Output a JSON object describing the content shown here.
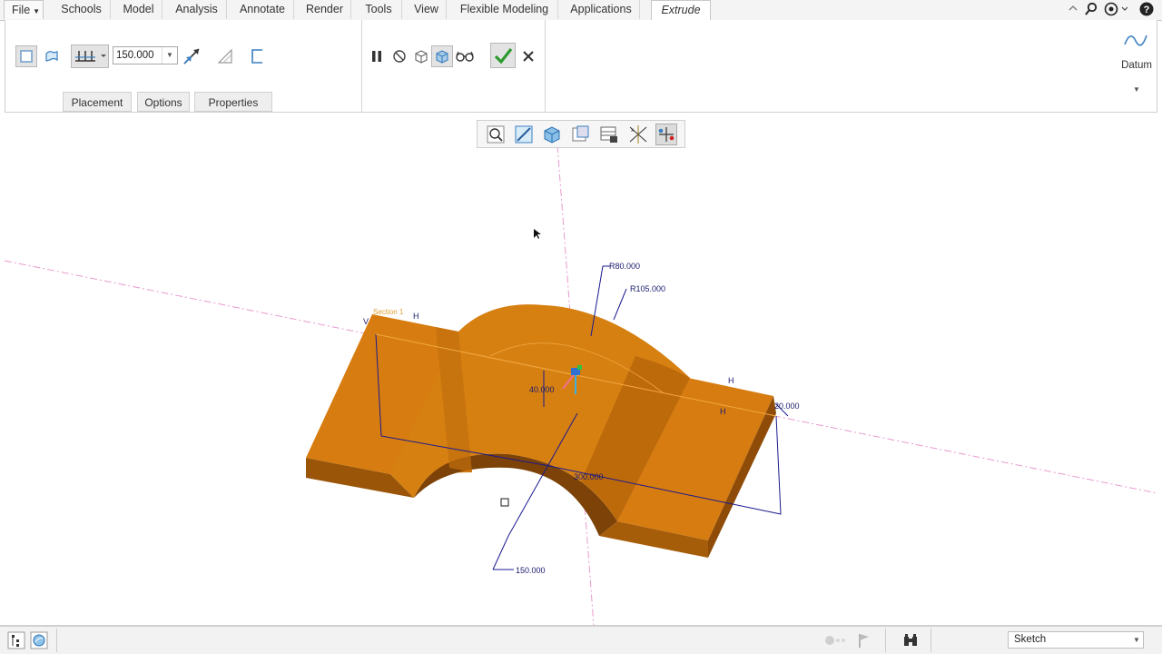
{
  "menubar": {
    "file_label": "File",
    "items": [
      "Schools",
      "Model",
      "Analysis",
      "Annotate",
      "Render",
      "Tools",
      "View",
      "Flexible Modeling",
      "Applications"
    ],
    "active_tab": "Extrude"
  },
  "ribbon": {
    "depth_value": "150.000",
    "tabs": {
      "placement": "Placement",
      "options": "Options",
      "properties": "Properties"
    },
    "datum_label": "Datum"
  },
  "viewport": {
    "dimensions": {
      "r80": "R80.000",
      "r105": "R105.000",
      "d40": "40.000",
      "d300": "300.000",
      "d20": "20.000",
      "d150": "150.000",
      "section": "Section 1",
      "h_mark": "H",
      "v_mark": "V"
    }
  },
  "statusbar": {
    "filter_value": "Sketch"
  },
  "colors": {
    "part_top": "#d97d10",
    "part_side": "#b8650a",
    "part_dark": "#8a4a08",
    "dim_blue": "#1a1a8e",
    "datum_pink": "#e080c0"
  }
}
